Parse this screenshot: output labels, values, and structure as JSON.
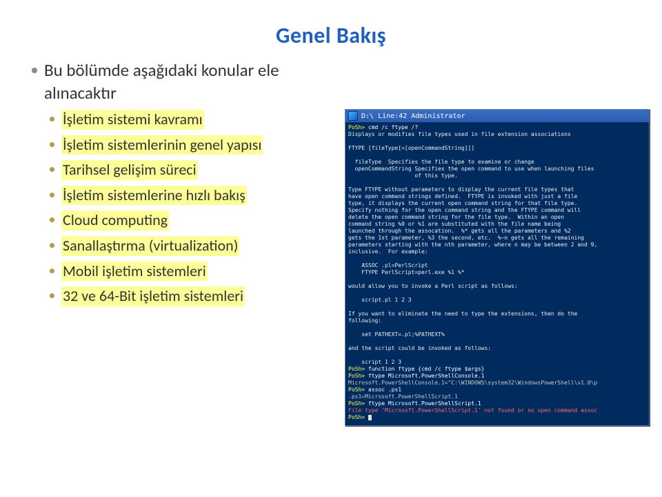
{
  "title": "Genel Bakış",
  "bullets": {
    "b1": "Bu bölümde aşağıdaki konular ele alınacaktır",
    "sub": [
      "İşletim sistemi kavramı",
      "İşletim sistemlerinin genel yapısı",
      "Tarihsel gelişim süreci",
      "İşletim sistemlerine hızlı bakış",
      "Cloud computing",
      "Sanallaştırma (virtualization)",
      "Mobil işletim sistemleri",
      "32 ve 64-Bit işletim sistemleri"
    ]
  },
  "console": {
    "title": "D:\\  Line:42  Administrator",
    "prompt": "PoSh>",
    "cmd1": "cmd /c ftype /?",
    "line_disp": "Displays or modifies file types used in file extension associations",
    "syn": "FTYPE [fileType[=[openCommandString]]]",
    "ft1": "  fileType  Specifies the file type to examine or change",
    "ft2": "  openCommandString Specifies the open command to use when launching files",
    "ft3": "                    of this type.",
    "p1": "Type FTYPE without parameters to display the current file types that",
    "p2": "have open command strings defined.  FTYPE is invoked with just a file",
    "p3": "type, it displays the current open command string for that file type.",
    "p4": "Specify nothing for the open command string and the FTYPE command will",
    "p5": "delete the open command string for the file type.  Within an open",
    "p6": "command string %0 or %1 are substituted with the file name being",
    "p7": "launched through the assocation.  %* gets all the parameters and %2",
    "p8": "gets the 1st parameter, %3 the second, etc.  %~n gets all the remaining",
    "p9": "parameters starting with the nth parameter, where n may be between 2 and 9,",
    "p10": "inclusive.  For example:",
    "ex1": "    ASSOC .pl=PerlScript",
    "ex2": "    FTYPE PerlScript=perl.exe %1 %*",
    "allow": "would allow you to invoke a Perl script as follows:",
    "ex3": "    script.pl 1 2 3",
    "elim1": "If you want to eliminate the need to type the extensions, then do the",
    "elim2": "following:",
    "ex4": "    set PATHEXT=.pl;%PATHEXT%",
    "inv": "and the script could be invoked as follows:",
    "ex5": "    script 1 2 3",
    "cmd2": "function ftype {cmd /c ftype $args}",
    "cmd3": "ftype Microsoft.PowerShellConsole.1",
    "out3": "Microsoft.PowerShellConsole.1=\"C:\\WINDOWS\\system32\\WindowsPowerShell\\v1.0\\p",
    "cmd4": "assoc .ps1",
    "out4": ".ps1=Microsoft.PowerShellScript.1",
    "cmd5": "ftype Microsoft.PowerShellScript.1",
    "err": "File type 'Microsoft.PowerShellScript.1' not found or no open command assoc"
  }
}
